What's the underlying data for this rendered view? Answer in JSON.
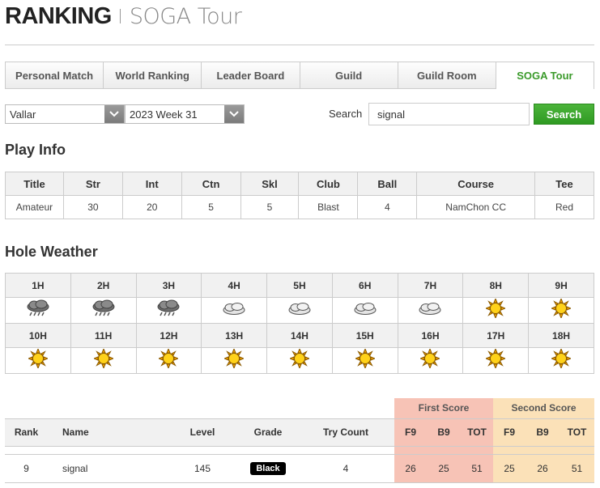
{
  "header": {
    "logo": "RANKING",
    "subtitle": "SOGA Tour"
  },
  "tabs": [
    {
      "label": "Personal Match",
      "active": false
    },
    {
      "label": "World Ranking",
      "active": false
    },
    {
      "label": "Leader Board",
      "active": false
    },
    {
      "label": "Guild",
      "active": false
    },
    {
      "label": "Guild Room",
      "active": false
    },
    {
      "label": "SOGA Tour",
      "active": true
    }
  ],
  "filters": {
    "server": "Vallar",
    "week": "2023 Week 31",
    "search_label": "Search",
    "search_value": "signal",
    "search_button": "Search"
  },
  "play_info": {
    "title": "Play Info",
    "headers": [
      "Title",
      "Str",
      "Int",
      "Ctn",
      "Skl",
      "Club",
      "Ball",
      "Course",
      "Tee"
    ],
    "values": [
      "Amateur",
      "30",
      "20",
      "5",
      "5",
      "Blast",
      "4",
      "NamChon CC",
      "Red"
    ]
  },
  "hole_weather": {
    "title": "Hole Weather",
    "holes": [
      {
        "label": "1H",
        "icon": "rain-cloud-icon"
      },
      {
        "label": "2H",
        "icon": "rain-cloud-icon"
      },
      {
        "label": "3H",
        "icon": "rain-cloud-icon"
      },
      {
        "label": "4H",
        "icon": "cloud-icon"
      },
      {
        "label": "5H",
        "icon": "cloud-icon"
      },
      {
        "label": "6H",
        "icon": "cloud-icon"
      },
      {
        "label": "7H",
        "icon": "cloud-icon"
      },
      {
        "label": "8H",
        "icon": "sun-icon"
      },
      {
        "label": "9H",
        "icon": "sun-icon"
      },
      {
        "label": "10H",
        "icon": "sun-icon"
      },
      {
        "label": "11H",
        "icon": "sun-icon"
      },
      {
        "label": "12H",
        "icon": "sun-icon"
      },
      {
        "label": "13H",
        "icon": "sun-icon"
      },
      {
        "label": "14H",
        "icon": "sun-icon"
      },
      {
        "label": "15H",
        "icon": "sun-icon"
      },
      {
        "label": "16H",
        "icon": "sun-icon"
      },
      {
        "label": "17H",
        "icon": "sun-icon"
      },
      {
        "label": "18H",
        "icon": "sun-icon"
      }
    ]
  },
  "ranking": {
    "groups": {
      "first": "First Score",
      "second": "Second Score"
    },
    "headers": {
      "rank": "Rank",
      "name": "Name",
      "level": "Level",
      "grade": "Grade",
      "try_count": "Try Count",
      "f9": "F9",
      "b9": "B9",
      "tot": "TOT",
      "f9_2": "F9",
      "b9_2": "B9",
      "tot_2": "TOT"
    },
    "row": {
      "rank": "9",
      "name": "signal",
      "level": "145",
      "grade": "Black",
      "try_count": "4",
      "first_f9": "26",
      "first_b9": "25",
      "first_tot": "51",
      "second_f9": "25",
      "second_b9": "26",
      "second_tot": "51"
    }
  },
  "colors": {
    "accent_green": "#3a9a2a",
    "first_score_bg": "#f7c3b6",
    "second_score_bg": "#fbe1b8"
  }
}
